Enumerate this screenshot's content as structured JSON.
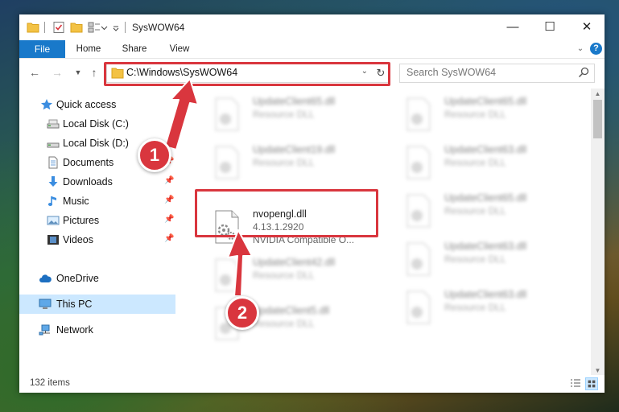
{
  "window": {
    "title": "SysWOW64",
    "controls": {
      "minimize": "—",
      "maximize": "☐",
      "close": "✕"
    }
  },
  "ribbon": {
    "tabs": [
      "File",
      "Home",
      "Share",
      "View"
    ],
    "help": "?"
  },
  "navigation": {
    "address_path": "C:\\Windows\\SysWOW64",
    "search_placeholder": "Search SysWOW64"
  },
  "sidebar": {
    "items": [
      {
        "label": "Quick access",
        "icon": "star-icon"
      },
      {
        "label": "Local Disk (C:)",
        "icon": "drive-icon"
      },
      {
        "label": "Local Disk (D:)",
        "icon": "drive-icon"
      },
      {
        "label": "Documents",
        "icon": "documents-icon"
      },
      {
        "label": "Downloads",
        "icon": "download-icon"
      },
      {
        "label": "Music",
        "icon": "music-icon"
      },
      {
        "label": "Pictures",
        "icon": "pictures-icon"
      },
      {
        "label": "Videos",
        "icon": "videos-icon"
      },
      {
        "label": "OneDrive",
        "icon": "cloud-icon"
      },
      {
        "label": "This PC",
        "icon": "computer-icon",
        "selected": true
      },
      {
        "label": "Network",
        "icon": "network-icon"
      }
    ]
  },
  "files": [
    {
      "name": "UpdateClient65.dll",
      "line2": "Resource DLL"
    },
    {
      "name": "UpdateClient65.dll",
      "line2": "Resource DLL"
    },
    {
      "name": "UpdateClient19.dll",
      "line2": "Resource DLL"
    },
    {
      "name": "UpdateClient63.dll",
      "line2": "Resource DLL"
    },
    {
      "name": "nvopengl.dll",
      "line2": "4.13.1.2920",
      "line3": "NVIDIA Compatible O...",
      "highlighted": true
    },
    {
      "name": "UpdateClient65.dll",
      "line2": "Resource DLL"
    },
    {
      "name": "UpdateClient42.dll",
      "line2": "Resource DLL"
    },
    {
      "name": "UpdateClient63.dll",
      "line2": "Resource DLL"
    },
    {
      "name": "UpdateClient5.dll",
      "line2": "Resource DLL"
    },
    {
      "name": "UpdateClient63.dll",
      "line2": "Resource DLL"
    }
  ],
  "status": {
    "item_count": "132 items"
  },
  "annotations": {
    "step1": "1",
    "step2": "2",
    "accent_color": "#d9363e"
  },
  "colors": {
    "file_tab": "#1979ca",
    "selection": "#cce8ff"
  }
}
